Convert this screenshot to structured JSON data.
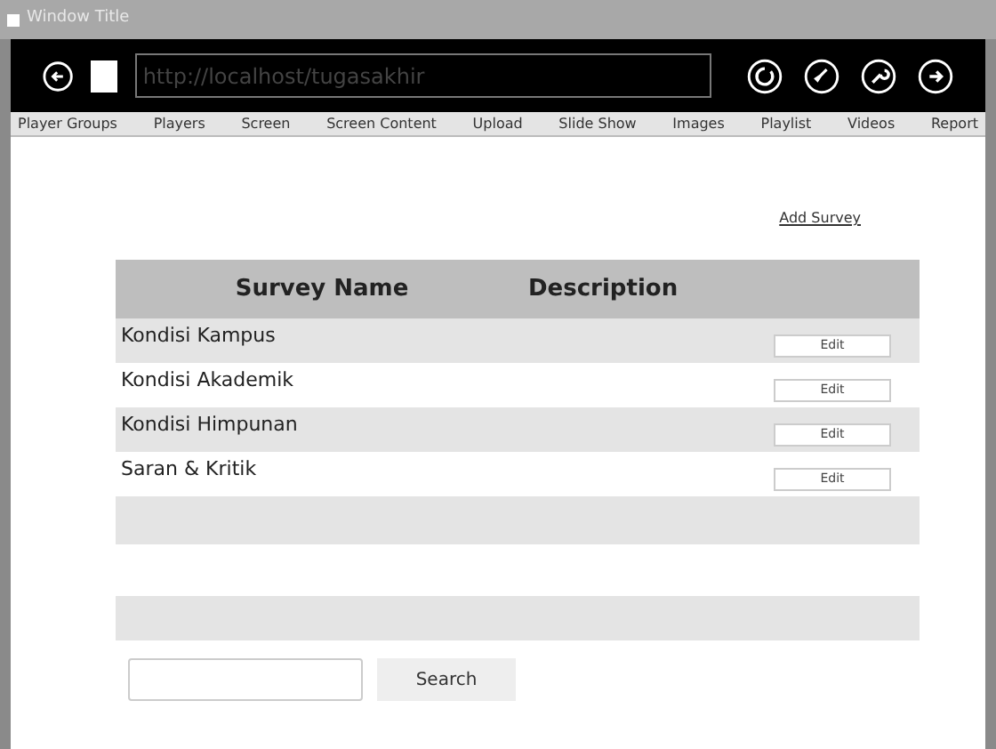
{
  "window": {
    "title": "Window Title"
  },
  "toolbar": {
    "address": "http://localhost/tugasakhir"
  },
  "nav": [
    {
      "label": "Player Groups"
    },
    {
      "label": "Players"
    },
    {
      "label": "Screen"
    },
    {
      "label": "Screen Content"
    },
    {
      "label": "Upload"
    },
    {
      "label": "Slide Show"
    },
    {
      "label": "Images"
    },
    {
      "label": "Playlist"
    },
    {
      "label": "Videos"
    },
    {
      "label": "Report"
    }
  ],
  "add_link": "Add Survey",
  "table": {
    "columns": [
      "Survey Name",
      "Description"
    ],
    "rows": [
      {
        "name": "Kondisi Kampus",
        "action": "Edit"
      },
      {
        "name": "Kondisi Akademik",
        "action": "Edit"
      },
      {
        "name": "Kondisi Himpunan",
        "action": "Edit"
      },
      {
        "name": "Saran & Kritik",
        "action": "Edit"
      }
    ]
  },
  "search": {
    "button": "Search"
  }
}
